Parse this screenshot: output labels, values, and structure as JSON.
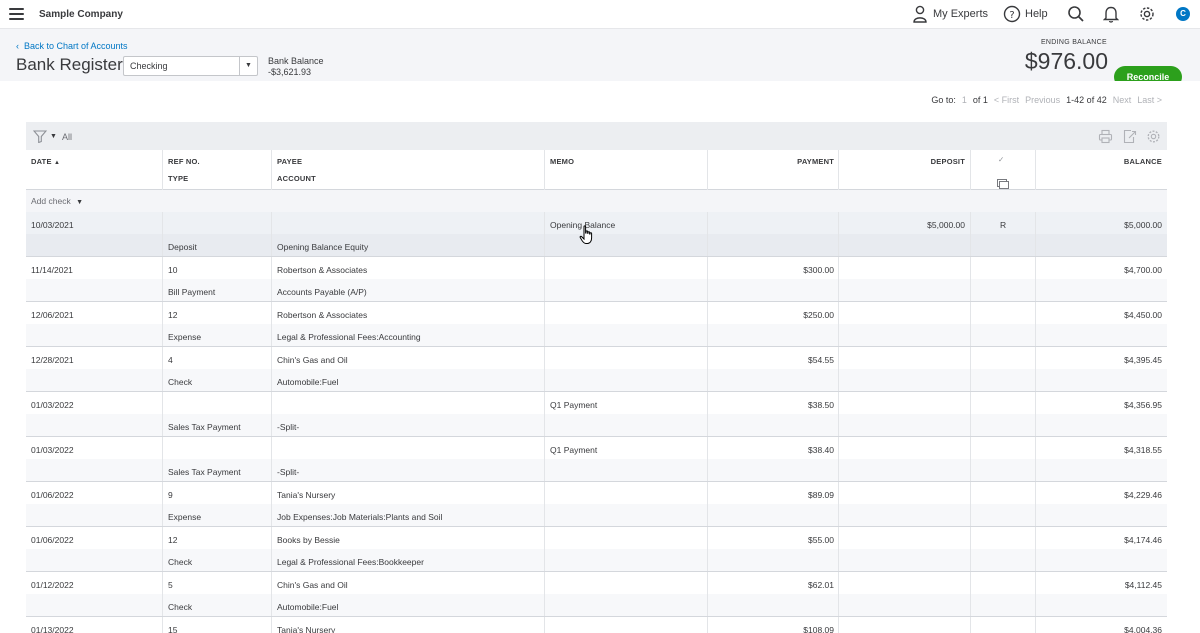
{
  "topbar": {
    "company": "Sample Company",
    "my_experts": "My Experts",
    "help": "Help",
    "avatar_initial": "C"
  },
  "header": {
    "back_link": "Back to Chart of Accounts",
    "title": "Bank Register",
    "account_select": "Checking",
    "bank_balance_label": "Bank Balance",
    "bank_balance_value": "-$3,621.93",
    "ending_balance_label": "ENDING BALANCE",
    "ending_balance_value": "$976.00",
    "reconcile_label": "Reconcile"
  },
  "pager": {
    "goto_label": "Go to:",
    "page": "1",
    "of_pages": "of 1",
    "first": "< First",
    "previous": "Previous",
    "range": "1-42 of 42",
    "next": "Next",
    "last": "Last >"
  },
  "toolbar": {
    "filter_label": "All"
  },
  "columns": {
    "date": "DATE",
    "ref_no": "REF NO.",
    "type": "TYPE",
    "payee": "PAYEE",
    "account": "ACCOUNT",
    "memo": "MEMO",
    "payment": "PAYMENT",
    "deposit": "DEPOSIT",
    "balance": "BALANCE"
  },
  "add_check_label": "Add check",
  "rows": [
    {
      "date": "10/03/2021",
      "ref": "",
      "type": "Deposit",
      "payee": "",
      "account": "Opening Balance Equity",
      "memo": "Opening Balance",
      "payment": "",
      "deposit": "$5,000.00",
      "status": "R",
      "balance": "$5,000.00"
    },
    {
      "date": "11/14/2021",
      "ref": "10",
      "type": "Bill Payment",
      "payee": "Robertson & Associates",
      "account": "Accounts Payable (A/P)",
      "memo": "",
      "payment": "$300.00",
      "deposit": "",
      "status": "",
      "balance": "$4,700.00"
    },
    {
      "date": "12/06/2021",
      "ref": "12",
      "type": "Expense",
      "payee": "Robertson & Associates",
      "account": "Legal & Professional Fees:Accounting",
      "memo": "",
      "payment": "$250.00",
      "deposit": "",
      "status": "",
      "balance": "$4,450.00"
    },
    {
      "date": "12/28/2021",
      "ref": "4",
      "type": "Check",
      "payee": "Chin's Gas and Oil",
      "account": "Automobile:Fuel",
      "memo": "",
      "payment": "$54.55",
      "deposit": "",
      "status": "",
      "balance": "$4,395.45"
    },
    {
      "date": "01/03/2022",
      "ref": "",
      "type": "Sales Tax Payment",
      "payee": "",
      "account": "-Split-",
      "memo": "Q1 Payment",
      "payment": "$38.50",
      "deposit": "",
      "status": "",
      "balance": "$4,356.95"
    },
    {
      "date": "01/03/2022",
      "ref": "",
      "type": "Sales Tax Payment",
      "payee": "",
      "account": "-Split-",
      "memo": "Q1 Payment",
      "payment": "$38.40",
      "deposit": "",
      "status": "",
      "balance": "$4,318.55"
    },
    {
      "date": "01/06/2022",
      "ref": "9",
      "type": "Expense",
      "payee": "Tania's Nursery",
      "account": "Job Expenses:Job Materials:Plants and Soil",
      "memo": "",
      "payment": "$89.09",
      "deposit": "",
      "status": "",
      "balance": "$4,229.46"
    },
    {
      "date": "01/06/2022",
      "ref": "12",
      "type": "Check",
      "payee": "Books by Bessie",
      "account": "Legal & Professional Fees:Bookkeeper",
      "memo": "",
      "payment": "$55.00",
      "deposit": "",
      "status": "",
      "balance": "$4,174.46"
    },
    {
      "date": "01/12/2022",
      "ref": "5",
      "type": "Check",
      "payee": "Chin's Gas and Oil",
      "account": "Automobile:Fuel",
      "memo": "",
      "payment": "$62.01",
      "deposit": "",
      "status": "",
      "balance": "$4,112.45"
    },
    {
      "date": "01/13/2022",
      "ref": "15",
      "type": "",
      "payee": "Tania's Nursery",
      "account": "",
      "memo": "",
      "payment": "$108.09",
      "deposit": "",
      "status": "",
      "balance": "$4,004.36"
    }
  ]
}
